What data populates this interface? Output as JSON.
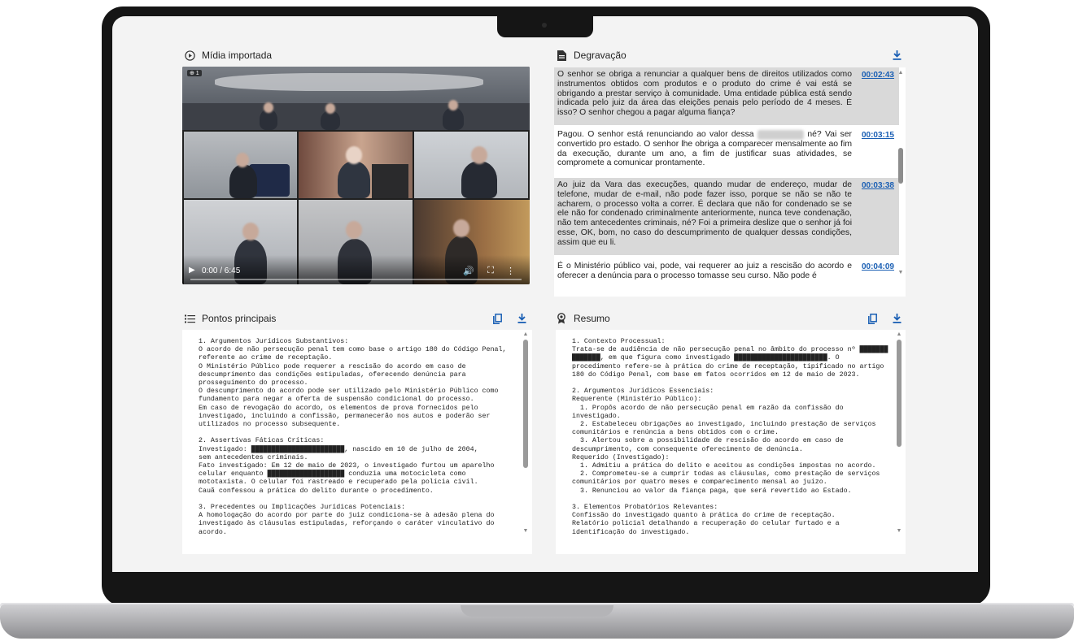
{
  "media": {
    "title": "Mídia importada",
    "video": {
      "time": "0:00 / 6:45",
      "badge": "⊕ 1",
      "progress": 0
    }
  },
  "transcript": {
    "title": "Degravação",
    "segments": [
      {
        "text": "O senhor se obriga a renunciar a qualquer bens de direitos utilizados como instrumentos obtidos com produtos e o produto do crime é vai está se obrigando a prestar serviço à comunidade. Uma entidade pública está sendo indicada pelo juiz da área das eleições penais pelo período de 4 meses. É isso? O senhor chegou a pagar alguma fiança?",
        "timestamp": "00:02:43"
      },
      {
        "text_before": "Pagou. O senhor está renunciando ao valor dessa",
        "text_after": "né? Vai ser convertido pro estado. O senhor lhe obriga a comparecer mensalmente ao fim da execução, durante um ano, a fim de justificar suas atividades, se compromete a comunicar prontamente.",
        "timestamp": "00:03:15"
      },
      {
        "text": "Ao juiz da Vara das execuções, quando mudar de endereço, mudar de telefone, mudar de e-mail, não pode fazer isso, porque se não se não te acharem, o processo volta a correr. É declara que não for condenado se se ele não for condenado criminalmente anteriormente, nunca teve condenação, não tem antecedentes criminais, né? Foi a primeira deslize que o senhor já foi esse, OK, bom, no caso do descumprimento de qualquer dessas condições, assim que eu li.",
        "timestamp": "00:03:38"
      },
      {
        "text": "É o Ministério público vai, pode, vai requerer ao juiz a rescisão do acordo e oferecer a denúncia para o processo tomasse seu curso. Não pode é",
        "timestamp": "00:04:09"
      }
    ]
  },
  "key_points": {
    "title": "Pontos principais",
    "lines": [
      "1. Argumentos Jurídicos Substantivos:",
      "O acordo de não persecução penal tem como base o artigo 180 do Código Penal,",
      "referente ao crime de receptação.",
      "O Ministério Público pode requerer a rescisão do acordo em caso de",
      "descumprimento das condições estipuladas, oferecendo denúncia para",
      "prosseguimento do processo.",
      "O descumprimento do acordo pode ser utilizado pelo Ministério Público como",
      "fundamento para negar a oferta de suspensão condicional do processo.",
      "Em caso de revogação do acordo, os elementos de prova fornecidos pelo",
      "investigado, incluindo a confissão, permanecerão nos autos e poderão ser",
      "utilizados no processo subsequente.",
      "",
      "2. Assertivas Fáticas Críticas:",
      "Investigado: ███████████████████████, nascido em 10 de julho de 2004,",
      "sem antecedentes criminais.",
      "Fato investigado: Em 12 de maio de 2023, o investigado furtou um aparelho",
      "celular enquanto ███████████████████ conduzia uma motocicleta como",
      "mototaxista. O celular foi rastreado e recuperado pela polícia civil.",
      "Cauã confessou a prática do delito durante o procedimento.",
      "",
      "3. Precedentes ou Implicações Jurídicas Potenciais:",
      "A homologação do acordo por parte do juiz condiciona-se à adesão plena do",
      "investigado às cláusulas estipuladas, reforçando o caráter vinculativo do",
      "acordo."
    ]
  },
  "summary": {
    "title": "Resumo",
    "lines": [
      "1. Contexto Processual:",
      "Trata-se de audiência de não persecução penal no âmbito do processo nº ███████",
      "███████, em que figura como investigado ███████████████████████. O",
      "procedimento refere-se à prática do crime de receptação, tipificado no artigo",
      "180 do Código Penal, com base em fatos ocorridos em 12 de maio de 2023.",
      "",
      "2. Argumentos Jurídicos Essenciais:",
      "Requerente (Ministério Público):",
      "  1. Propôs acordo de não persecução penal em razão da confissão do",
      "investigado.",
      "  2. Estabeleceu obrigações ao investigado, incluindo prestação de serviços",
      "comunitários e renúncia a bens obtidos com o crime.",
      "  3. Alertou sobre a possibilidade de rescisão do acordo em caso de",
      "descumprimento, com consequente oferecimento de denúncia.",
      "Requerido (Investigado):",
      "  1. Admitiu a prática do delito e aceitou as condições impostas no acordo.",
      "  2. Comprometeu-se a cumprir todas as cláusulas, como prestação de serviços",
      "comunitários por quatro meses e comparecimento mensal ao juízo.",
      "  3. Renunciou ao valor da fiança paga, que será revertido ao Estado.",
      "",
      "3. Elementos Probatórios Relevantes:",
      "Confissão do investigado quanto à prática do crime de receptação.",
      "Relatório policial detalhando a recuperação do celular furtado e a",
      "identificação do investigado."
    ]
  }
}
